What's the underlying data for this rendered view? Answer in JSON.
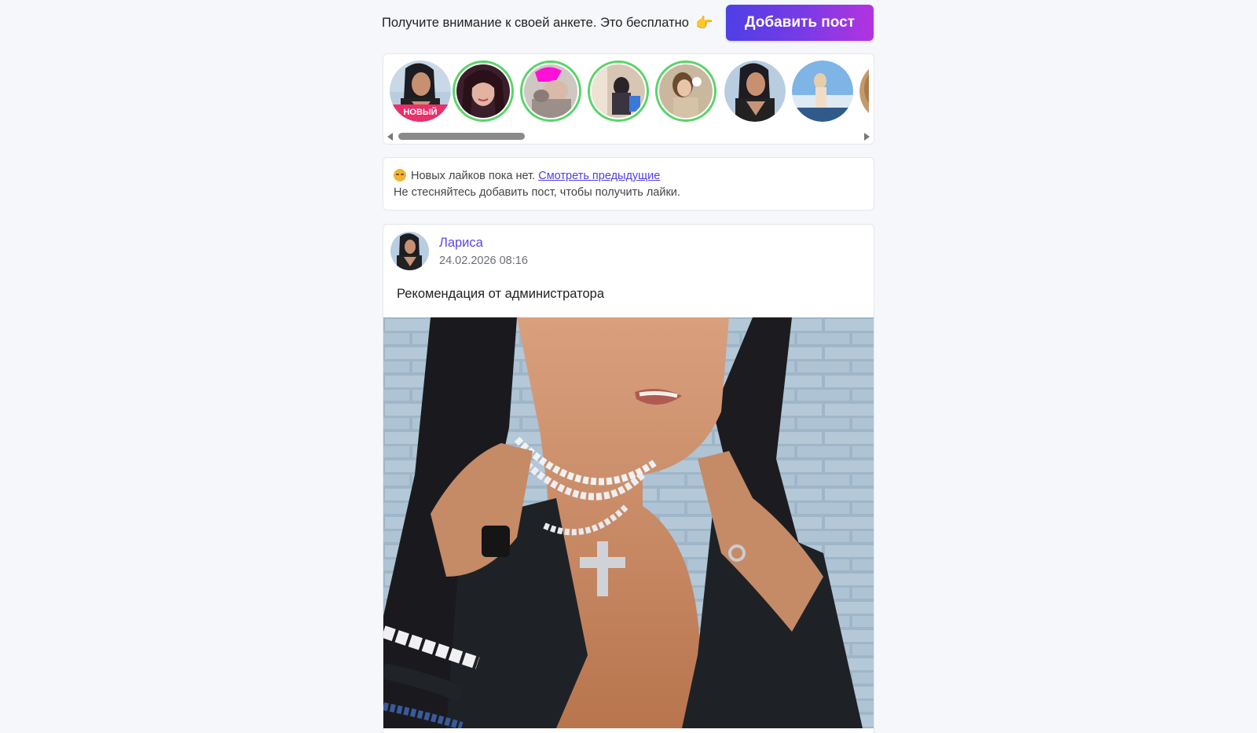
{
  "promo": {
    "text": "Получите внимание к своей анкете. Это бесплатно",
    "emoji": "👉",
    "button_label": "Добавить пост"
  },
  "stories": {
    "items": [
      {
        "badge": "НОВЫЙ",
        "ring": false
      },
      {
        "badge": "",
        "ring": true
      },
      {
        "badge": "",
        "ring": true
      },
      {
        "badge": "",
        "ring": true
      },
      {
        "badge": "",
        "ring": true
      },
      {
        "badge": "",
        "ring": false
      },
      {
        "badge": "",
        "ring": false
      },
      {
        "badge": "",
        "ring": false
      }
    ],
    "scroll_position": 0.0
  },
  "likes_notice": {
    "line1": "Новых лайков пока нет.",
    "link": "Смотреть предыдущие",
    "line2": "Не стесняйтесь добавить пост, чтобы получить лайки."
  },
  "post": {
    "author": "Лариса",
    "date": "24.02.2026 08:16",
    "text": "Рекомендация от администратора"
  },
  "colors": {
    "accent": "#5b45e6",
    "button_gradient_start": "#4f3fe6",
    "button_gradient_end": "#b334e0",
    "story_ring": "#5ad46a",
    "new_badge": "#e8306a",
    "page_bg": "#f6f7fa"
  }
}
